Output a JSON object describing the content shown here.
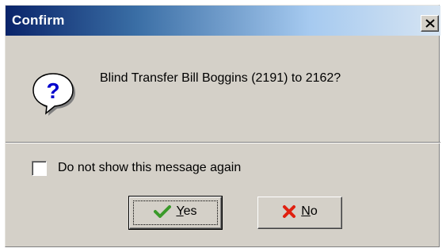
{
  "window": {
    "title": "Confirm",
    "close_icon": "close-icon"
  },
  "message": {
    "icon": "question-icon",
    "text": "Blind Transfer Bill Boggins (2191) to 2162?"
  },
  "checkbox": {
    "label": "Do not show this message again",
    "checked": false
  },
  "buttons": {
    "yes": {
      "label": "Yes",
      "mnemonic": "Y",
      "rest": "es",
      "icon": "checkmark-icon",
      "icon_color": "#3a9a2a",
      "default": true
    },
    "no": {
      "label": "No",
      "mnemonic": "N",
      "rest": "o",
      "icon": "red-x-icon",
      "icon_color": "#e02010"
    }
  },
  "colors": {
    "titlebar_start": "#0a246a",
    "titlebar_end": "#d6e4f2",
    "dialog_face": "#d4d0c8"
  }
}
